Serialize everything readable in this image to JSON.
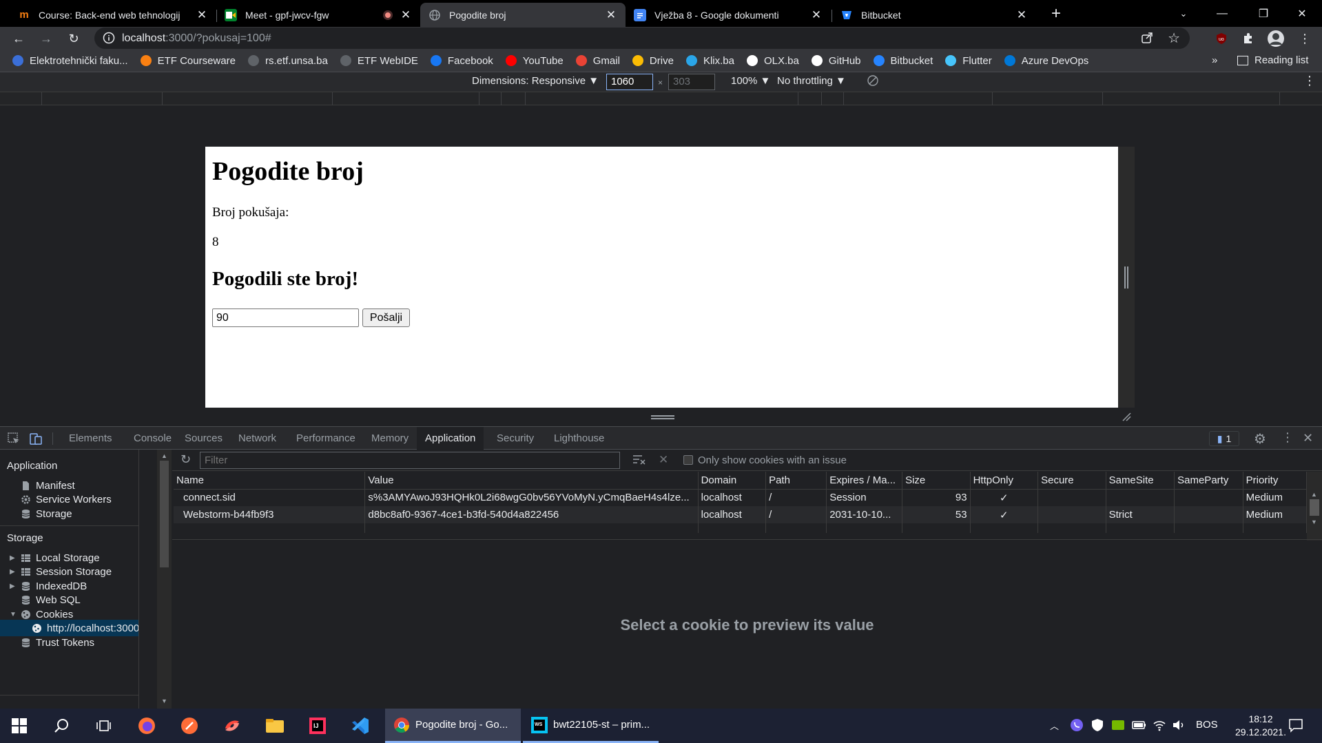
{
  "browser": {
    "tabs": [
      {
        "title": "Course: Back-end web tehnologij",
        "active": false
      },
      {
        "title": "Meet - gpf-jwcv-fgw",
        "active": false
      },
      {
        "title": "Pogodite broj",
        "active": true
      },
      {
        "title": "Vježba 8 - Google dokumenti",
        "active": false
      },
      {
        "title": "Bitbucket",
        "active": false
      }
    ],
    "address": {
      "host": "localhost",
      "rest": ":3000/?pokusaj=100#"
    },
    "bookmarks": [
      {
        "label": "Elektrotehnički faku...",
        "icon": "etf-icon",
        "color": "#3b6fd8"
      },
      {
        "label": "ETF Courseware",
        "icon": "moodle-icon",
        "color": "#f98012"
      },
      {
        "label": "rs.etf.unsa.ba",
        "icon": "globe-icon",
        "color": "#5f6368"
      },
      {
        "label": "ETF WebIDE",
        "icon": "globe-icon",
        "color": "#5f6368"
      },
      {
        "label": "Facebook",
        "icon": "facebook-icon",
        "color": "#1877f2"
      },
      {
        "label": "YouTube",
        "icon": "youtube-icon",
        "color": "#ff0000"
      },
      {
        "label": "Gmail",
        "icon": "gmail-icon",
        "color": "#ea4335"
      },
      {
        "label": "Drive",
        "icon": "drive-icon",
        "color": "#fbbc04"
      },
      {
        "label": "Klix.ba",
        "icon": "klix-icon",
        "color": "#2aa5e8"
      },
      {
        "label": "OLX.ba",
        "icon": "olx-icon",
        "color": "#ffffff"
      },
      {
        "label": "GitHub",
        "icon": "github-icon",
        "color": "#ffffff"
      },
      {
        "label": "Bitbucket",
        "icon": "bitbucket-icon",
        "color": "#2684ff"
      },
      {
        "label": "Flutter",
        "icon": "flutter-icon",
        "color": "#47c5fb"
      },
      {
        "label": "Azure DevOps",
        "icon": "azure-devops-icon",
        "color": "#0078d7"
      }
    ],
    "more_bookmarks": "»",
    "reading_list": "Reading list"
  },
  "device_toolbar": {
    "dimensions": "Dimensions: Responsive ▼",
    "width": "1060",
    "height": "303",
    "zoom": "100% ▼",
    "throttling": "No throttling ▼"
  },
  "page": {
    "title": "Pogodite broj",
    "attempts_label": "Broj pokušaja:",
    "attempts_value": "8",
    "result": "Pogodili ste broj!",
    "input_value": "90",
    "submit_label": "Pošalji"
  },
  "devtools": {
    "tabs": [
      "Elements",
      "Console",
      "Sources",
      "Network",
      "Performance",
      "Memory",
      "Application",
      "Security",
      "Lighthouse"
    ],
    "active_tab": "Application",
    "issues_count": "1",
    "sidebar": {
      "application_header": "Application",
      "application_items": [
        "Manifest",
        "Service Workers",
        "Storage"
      ],
      "storage_header": "Storage",
      "storage_items": [
        "Local Storage",
        "Session Storage",
        "IndexedDB",
        "Web SQL",
        "Cookies"
      ],
      "cookie_origin": "http://localhost:3000",
      "trust_tokens": "Trust Tokens"
    },
    "filter_placeholder": "Filter",
    "only_issues_label": "Only show cookies with an issue",
    "columns": [
      "Name",
      "Value",
      "Domain",
      "Path",
      "Expires / Ma...",
      "Size",
      "HttpOnly",
      "Secure",
      "SameSite",
      "SameParty",
      "Priority"
    ],
    "cookies": [
      [
        "connect.sid",
        "s%3AMYAwoJ93HQHk0L2i68wgG0bv56YVoMyN.yCmqBaeH4s4lze...",
        "localhost",
        "/",
        "Session",
        "93",
        "✓",
        "",
        "",
        "",
        "Medium"
      ],
      [
        "Webstorm-b44fb9f3",
        "d8bc8af0-9367-4ce1-b3fd-540d4a822456",
        "localhost",
        "/",
        "2031-10-10...",
        "53",
        "✓",
        "",
        "Strict",
        "",
        "Medium"
      ]
    ],
    "preview_placeholder": "Select a cookie to preview its value"
  },
  "taskbar": {
    "apps": [
      {
        "label": "Pogodite broj - Go..."
      },
      {
        "label": "bwt22105-st – prim..."
      }
    ],
    "language": "BOS",
    "time": "18:12",
    "date": "29.12.2021."
  },
  "colors": {
    "accent": "#8ab4f8",
    "selection": "#073655"
  }
}
